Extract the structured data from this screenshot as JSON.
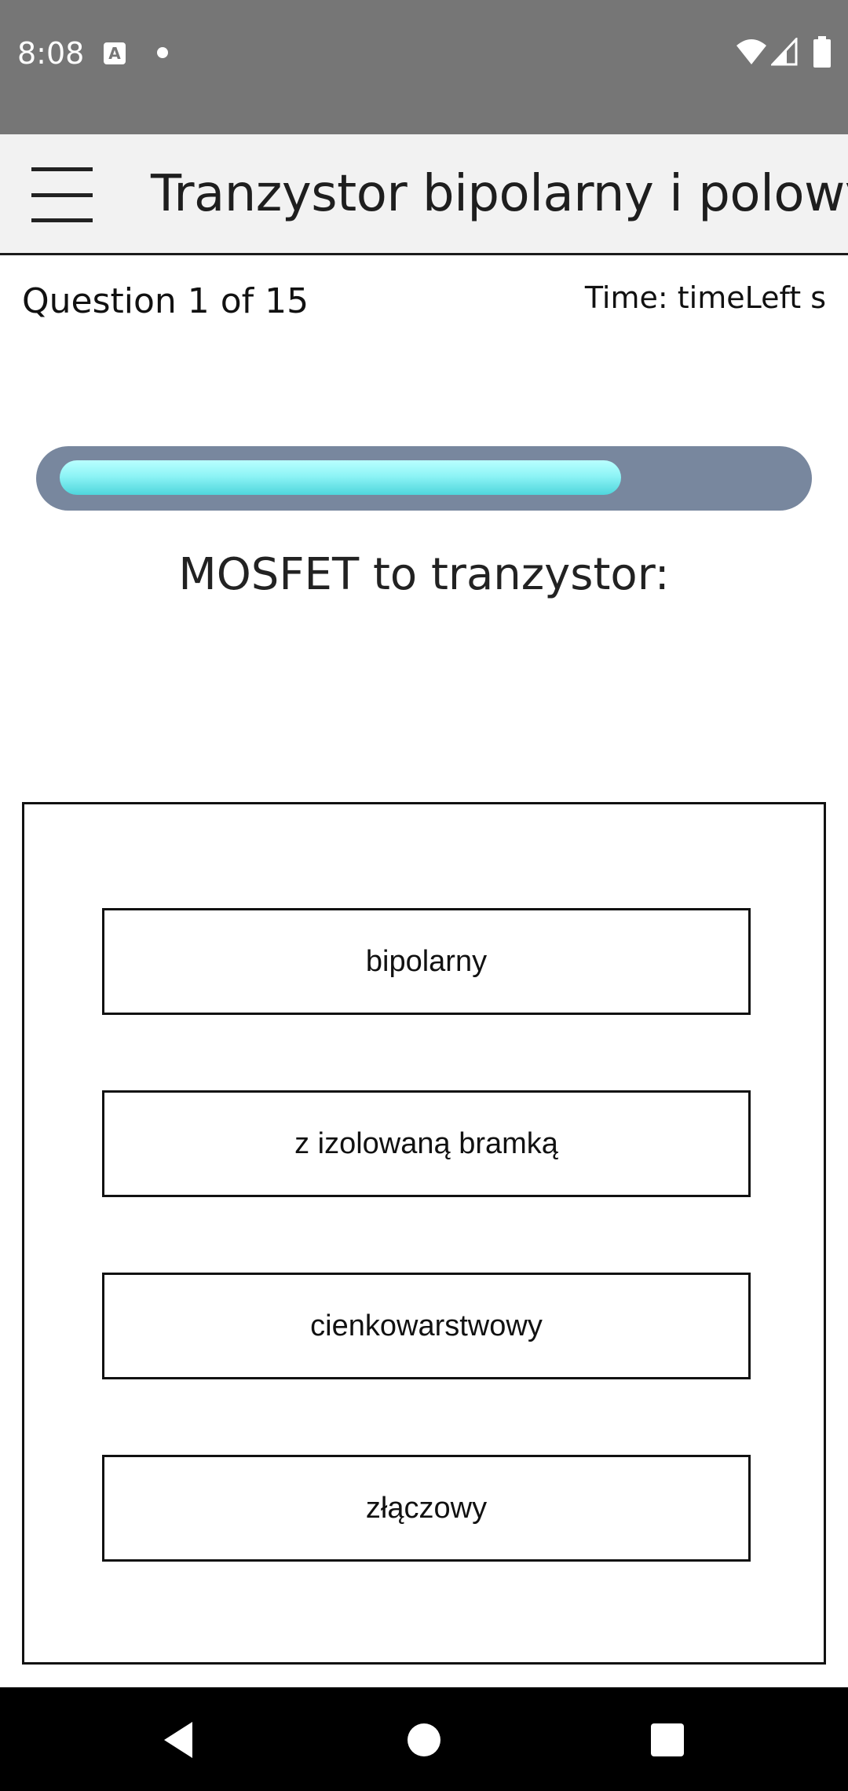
{
  "status_bar": {
    "time": "8:08",
    "icons": [
      "a-notification-icon",
      "dot-notification-icon",
      "wifi-icon",
      "cell-signal-icon",
      "battery-icon"
    ],
    "background_color": "#767676"
  },
  "app_bar": {
    "title": "Tranzystor bipolarny i polowy",
    "menu_icon": "hamburger-menu-icon",
    "background_color": "#f2f2f2"
  },
  "quiz": {
    "counter": "Question 1 of 15",
    "time_label": "Time: timeLeft s",
    "progress_fraction": 0.77,
    "progress_colors": {
      "track": "#78879e",
      "fill": "#8ef4f6"
    },
    "question": "MOSFET to tranzystor:",
    "answers": [
      {
        "label": "bipolarny"
      },
      {
        "label": "z izolowaną bramką"
      },
      {
        "label": "cienkowarstwowy"
      },
      {
        "label": "złączowy"
      }
    ]
  },
  "nav_bar": {
    "icons": [
      "back-icon",
      "home-icon",
      "recents-icon"
    ]
  }
}
